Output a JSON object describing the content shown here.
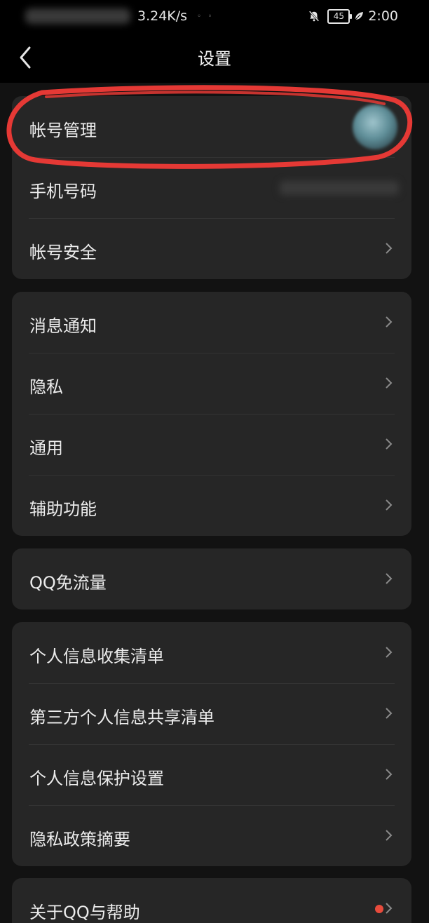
{
  "status_bar": {
    "network_speed": "3.24K/s",
    "battery_level": "45",
    "time": "2:00",
    "icons": [
      "bell-off-icon",
      "battery-icon",
      "leaf-icon"
    ]
  },
  "header": {
    "title": "设置",
    "back_icon": "back-arrow-icon"
  },
  "groups": [
    {
      "items": [
        {
          "label": "帐号管理",
          "trailing": "avatar"
        },
        {
          "label": "手机号码",
          "trailing": "blurred-phone-number"
        },
        {
          "label": "帐号安全",
          "trailing": "chevron-right-icon"
        }
      ]
    },
    {
      "items": [
        {
          "label": "消息通知",
          "trailing": "chevron-right-icon"
        },
        {
          "label": "隐私",
          "trailing": "chevron-right-icon"
        },
        {
          "label": "通用",
          "trailing": "chevron-right-icon"
        },
        {
          "label": "辅助功能",
          "trailing": "chevron-right-icon"
        }
      ]
    },
    {
      "items": [
        {
          "label": "QQ免流量",
          "trailing": "chevron-right-icon"
        }
      ]
    },
    {
      "items": [
        {
          "label": "个人信息收集清单",
          "trailing": "chevron-right-icon"
        },
        {
          "label": "第三方个人信息共享清单",
          "trailing": "chevron-right-icon"
        },
        {
          "label": "个人信息保护设置",
          "trailing": "chevron-right-icon"
        },
        {
          "label": "隐私政策摘要",
          "trailing": "chevron-right-icon"
        }
      ]
    },
    {
      "items": [
        {
          "label": "关于QQ与帮助",
          "trailing": "red-dot-badge"
        }
      ]
    }
  ],
  "colors": {
    "background": "#121212",
    "bars": "#000000",
    "card": "#262626",
    "text": "#ececec",
    "chevron": "#8a8a8a",
    "annotation_red": "#e53935",
    "badge_red": "#e84b3c"
  }
}
